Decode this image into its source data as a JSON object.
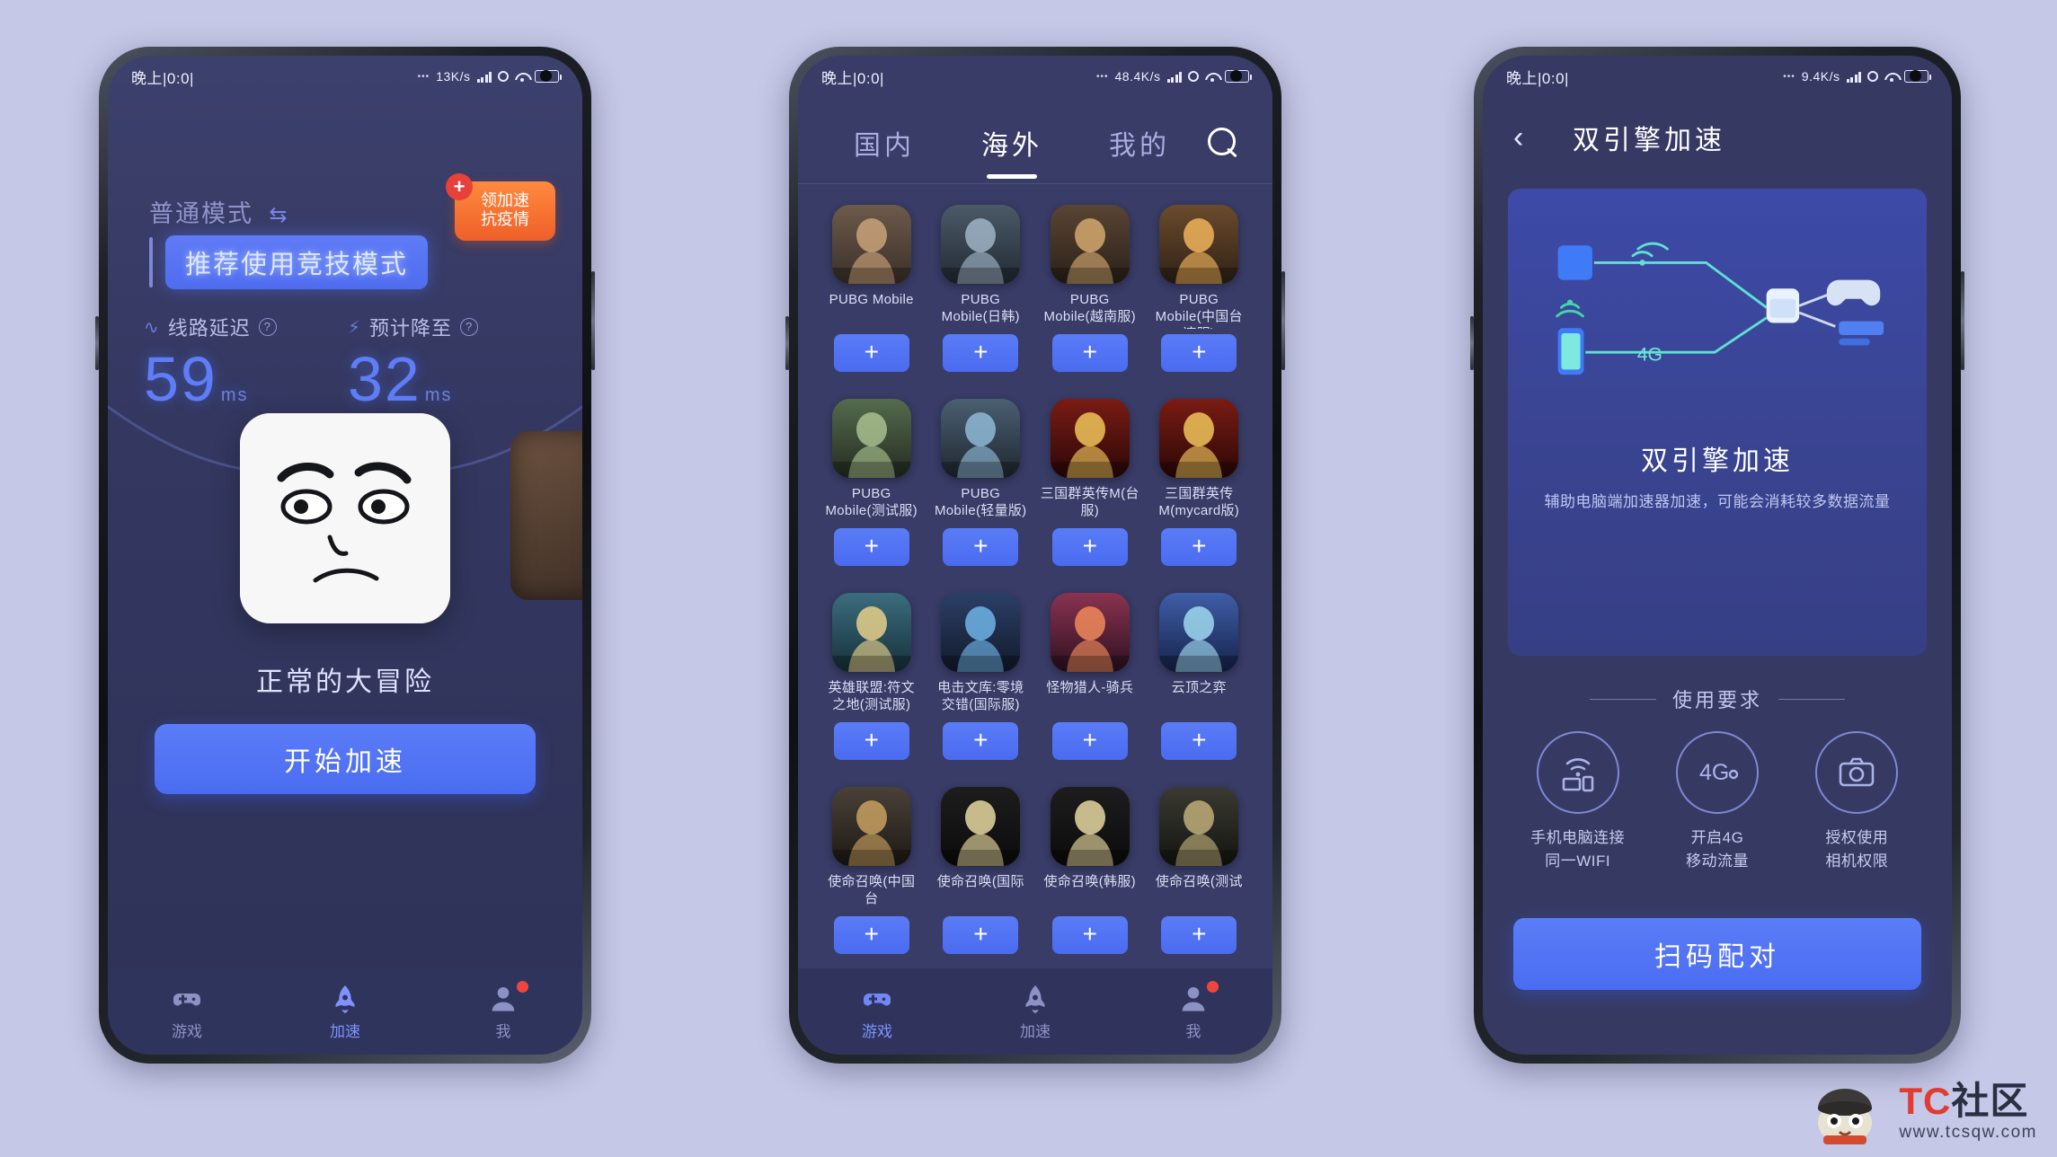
{
  "accent": "#4f6cf0",
  "bg": "#c5c8e6",
  "phone1": {
    "status": {
      "time": "晚上|0:0|",
      "dots": "•••",
      "speed": "13K/s",
      "battery": "49"
    },
    "mode_label": "普通模式",
    "mode_swap_icon": "swap-icon",
    "badge": "推荐使用竞技模式",
    "promo": {
      "line1": "领加速",
      "line2": "抗疫情",
      "cross_icon": "cross-icon"
    },
    "metrics": [
      {
        "icon": "pulse-icon",
        "label": "线路延迟",
        "help": "?",
        "value": "59",
        "unit": "ms"
      },
      {
        "icon": "bolt-icon",
        "label": "预计降至",
        "help": "?",
        "value": "32",
        "unit": "ms"
      }
    ],
    "game_title": "正常的大冒险",
    "cta": "开始加速",
    "nav": [
      {
        "icon": "gamepad-icon",
        "label": "游戏",
        "active": false
      },
      {
        "icon": "rocket-icon",
        "label": "加速",
        "active": true
      },
      {
        "icon": "person-icon",
        "label": "我",
        "active": false,
        "badge": true
      }
    ]
  },
  "phone2": {
    "status": {
      "time": "晚上|0:0|",
      "dots": "•••",
      "speed": "48.4K/s",
      "battery": "49"
    },
    "tabs": [
      {
        "label": "国内",
        "active": false
      },
      {
        "label": "海外",
        "active": true
      },
      {
        "label": "我的",
        "active": false
      }
    ],
    "search_icon": "search-icon",
    "add_label": "+",
    "games": [
      {
        "name": "PUBG Mobile",
        "art": "pubg1"
      },
      {
        "name": "PUBG Mobile(日韩)",
        "art": "pubg2"
      },
      {
        "name": "PUBG Mobile(越南服)",
        "art": "pubg3"
      },
      {
        "name": "PUBG Mobile(中国台湾服)",
        "art": "pubg4"
      },
      {
        "name": "PUBG Mobile(测试服)",
        "art": "pubg5"
      },
      {
        "name": "PUBG Mobile(轻量版)",
        "art": "pubg6"
      },
      {
        "name": "三国群英传M(台服)",
        "art": "sanguo1"
      },
      {
        "name": "三国群英传M(mycard版)",
        "art": "sanguo2"
      },
      {
        "name": "英雄联盟:符文之地(测试服)",
        "art": "lor"
      },
      {
        "name": "电击文库:零境交错(国际服)",
        "art": "dengeki"
      },
      {
        "name": "怪物猎人-骑兵",
        "art": "mh"
      },
      {
        "name": "云顶之弈",
        "art": "tft"
      },
      {
        "name": "使命召唤(中国台",
        "art": "cod1"
      },
      {
        "name": "使命召唤(国际",
        "art": "cod2"
      },
      {
        "name": "使命召唤(韩服)",
        "art": "cod3"
      },
      {
        "name": "使命召唤(测试",
        "art": "cod4"
      }
    ],
    "nav": [
      {
        "icon": "gamepad-icon",
        "label": "游戏",
        "active": true
      },
      {
        "icon": "rocket-icon",
        "label": "加速",
        "active": false
      },
      {
        "icon": "person-icon",
        "label": "我",
        "active": false,
        "badge": true
      }
    ]
  },
  "phone3": {
    "status": {
      "time": "晚上|0:0|",
      "dots": "•••",
      "speed": "9.4K/s",
      "battery": "49"
    },
    "back_icon": "chevron-left-icon",
    "title": "双引擎加速",
    "panel": {
      "heading": "双引擎加速",
      "desc": "辅助电脑端加速器加速，可能会消耗较多数据流量",
      "diagram_labels": {
        "mobile4g": "4G"
      }
    },
    "req_heading": "使用要求",
    "requirements": [
      {
        "icon": "wifi-devices-icon",
        "text": "手机电脑连接\n同一WIFI"
      },
      {
        "icon": "4g-icon",
        "text": "开启4G\n移动流量"
      },
      {
        "icon": "camera-icon",
        "text": "授权使用\n相机权限"
      }
    ],
    "cta": "扫码配对"
  },
  "watermark": {
    "main_tc": "TC",
    "main_sq": "社区",
    "sub": "www.tcsqw.com",
    "mascot": "mascot-icon"
  }
}
